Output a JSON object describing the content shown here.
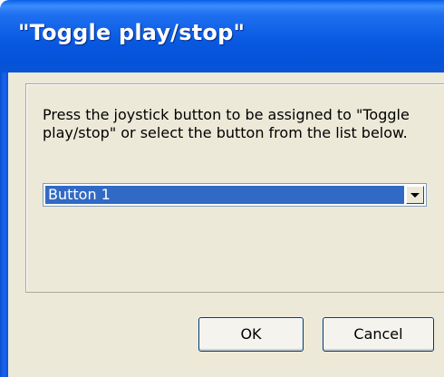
{
  "dialog": {
    "title": "\"Toggle play/stop\"",
    "prompt": "Press the joystick button to be assigned to \"Toggle play/stop\" or select the button from the list below.",
    "button_select": {
      "selected_value": "Button 1"
    },
    "ok_label": "OK",
    "cancel_label": "Cancel"
  },
  "icons": {
    "combo_arrow": "chevron-down-icon"
  },
  "colors": {
    "titlebar": "#0758e0",
    "client_background": "#ece9d8",
    "selection_highlight": "#316ac5"
  }
}
